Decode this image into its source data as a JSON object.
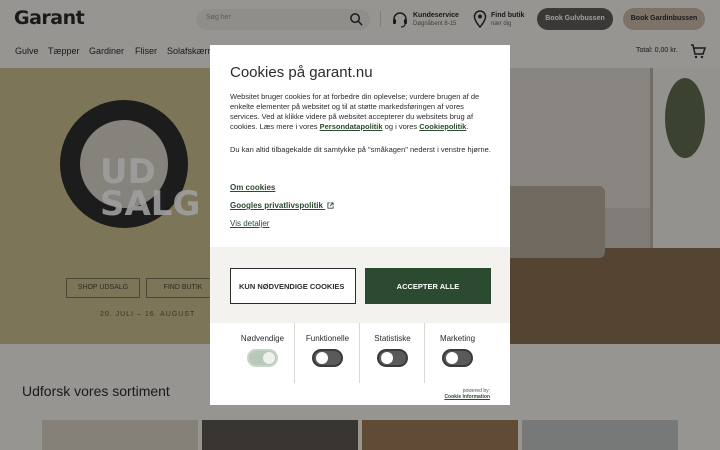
{
  "header": {
    "logo": "Garant",
    "search_placeholder": "Søg her",
    "customer_service": {
      "title": "Kundeservice",
      "sub": "Døgnåbent 8-15"
    },
    "find_store": {
      "title": "Find butik",
      "sub": "nær dig"
    },
    "btn_gulv": "Book Gulvbussen",
    "btn_gardin": "Book Gardinbussen"
  },
  "nav": {
    "items": [
      "Gulve",
      "Tæpper",
      "Gardiner",
      "Fliser",
      "Solafskærm"
    ],
    "cart_total": "Total: 0,00 kr."
  },
  "hero": {
    "sale_text_1": "UD",
    "sale_text_2": "SALG",
    "shop_label": "SHOP UDSALG",
    "find_label": "FIND BUTIK",
    "dates": "20. JULI – 16. AUGUST"
  },
  "section": {
    "title": "Udforsk vores sortiment"
  },
  "cookie": {
    "title": "Cookies på garant.nu",
    "body_text": "Websitet bruger cookies for at forbedre din oplevelse; vurdere brugen af de enkelte elementer på websitet og til at støtte markedsføringen af vores services. Ved at klikke videre på websitet accepterer du websitets brug af cookies. Læs mere i vores ",
    "privacy_link": "Persondatapolitik",
    "and_text": " og i vores ",
    "cookie_link": "Cookiepolitik",
    "end_text": ".",
    "body2": "Du kan altid tilbagekalde dit samtykke på \"småkagen\" nederst i venstre hjørne.",
    "about_link": "Om cookies",
    "google_link": "Googles privatlivspolitik",
    "details_link": "Vis detaljer",
    "btn_necessary": "KUN NØDVENDIGE COOKIES",
    "btn_accept": "ACCEPTER ALLE",
    "categories": [
      {
        "label": "Nødvendige",
        "enabled": true
      },
      {
        "label": "Funktionelle",
        "enabled": false
      },
      {
        "label": "Statistiske",
        "enabled": false
      },
      {
        "label": "Marketing",
        "enabled": false
      }
    ],
    "powered_by": "powered by:",
    "powered_name": "Cookie Information"
  },
  "colors": {
    "accent_green": "#2c4a2f",
    "sale_yellow": "#c9bd8e",
    "bg": "#f4f1ec"
  }
}
